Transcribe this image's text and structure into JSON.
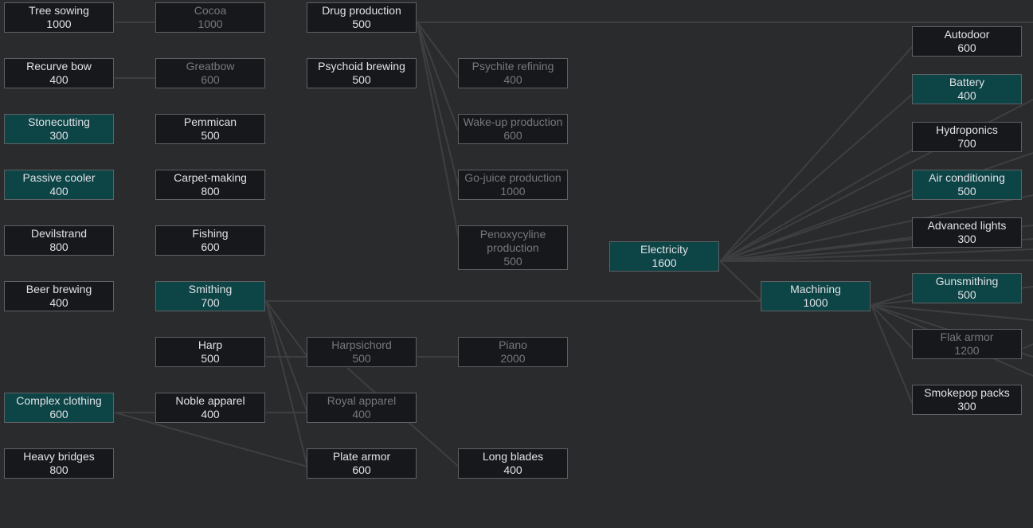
{
  "colors": {
    "background": "#2a2b2c",
    "node_default": "#17181c",
    "node_researched": "#0d4446",
    "node_border": "#5e6064",
    "text_available": "#dfe2e6",
    "text_locked": "#75787c",
    "connector": "#3e3f41"
  },
  "nodes": {
    "tree_sowing": {
      "name": "Tree sowing",
      "cost": "1000",
      "state": "available"
    },
    "recurve_bow": {
      "name": "Recurve bow",
      "cost": "400",
      "state": "available"
    },
    "stonecutting": {
      "name": "Stonecutting",
      "cost": "300",
      "state": "researched"
    },
    "passive_cooler": {
      "name": "Passive cooler",
      "cost": "400",
      "state": "researched"
    },
    "devilstrand": {
      "name": "Devilstrand",
      "cost": "800",
      "state": "available"
    },
    "beer_brewing": {
      "name": "Beer brewing",
      "cost": "400",
      "state": "available"
    },
    "complex_clothing": {
      "name": "Complex clothing",
      "cost": "600",
      "state": "researched"
    },
    "heavy_bridges": {
      "name": "Heavy bridges",
      "cost": "800",
      "state": "available"
    },
    "cocoa": {
      "name": "Cocoa",
      "cost": "1000",
      "state": "locked"
    },
    "greatbow": {
      "name": "Greatbow",
      "cost": "600",
      "state": "locked"
    },
    "pemmican": {
      "name": "Pemmican",
      "cost": "500",
      "state": "available"
    },
    "carpet_making": {
      "name": "Carpet-making",
      "cost": "800",
      "state": "available"
    },
    "fishing": {
      "name": "Fishing",
      "cost": "600",
      "state": "available"
    },
    "smithing": {
      "name": "Smithing",
      "cost": "700",
      "state": "researched"
    },
    "harp": {
      "name": "Harp",
      "cost": "500",
      "state": "available"
    },
    "noble_apparel": {
      "name": "Noble apparel",
      "cost": "400",
      "state": "available"
    },
    "drug_production": {
      "name": "Drug production",
      "cost": "500",
      "state": "available"
    },
    "psychoid_brewing": {
      "name": "Psychoid brewing",
      "cost": "500",
      "state": "available"
    },
    "harpsichord": {
      "name": "Harpsichord",
      "cost": "500",
      "state": "locked"
    },
    "royal_apparel": {
      "name": "Royal apparel",
      "cost": "400",
      "state": "locked"
    },
    "plate_armor": {
      "name": "Plate armor",
      "cost": "600",
      "state": "available"
    },
    "psychite_refining": {
      "name": "Psychite refining",
      "cost": "400",
      "state": "locked"
    },
    "wakeup_production": {
      "name": "Wake-up production",
      "cost": "600",
      "state": "locked"
    },
    "gojuice_production": {
      "name": "Go-juice production",
      "cost": "1000",
      "state": "locked"
    },
    "penoxycyline_production": {
      "name": "Penoxycyline production",
      "cost": "500",
      "state": "locked"
    },
    "piano": {
      "name": "Piano",
      "cost": "2000",
      "state": "locked"
    },
    "long_blades": {
      "name": "Long blades",
      "cost": "400",
      "state": "available"
    },
    "electricity": {
      "name": "Electricity",
      "cost": "1600",
      "state": "researched"
    },
    "machining": {
      "name": "Machining",
      "cost": "1000",
      "state": "researched"
    },
    "autodoor": {
      "name": "Autodoor",
      "cost": "600",
      "state": "available"
    },
    "battery": {
      "name": "Battery",
      "cost": "400",
      "state": "researched"
    },
    "hydroponics": {
      "name": "Hydroponics",
      "cost": "700",
      "state": "available"
    },
    "air_conditioning": {
      "name": "Air conditioning",
      "cost": "500",
      "state": "researched"
    },
    "advanced_lights": {
      "name": "Advanced lights",
      "cost": "300",
      "state": "available"
    },
    "gunsmithing": {
      "name": "Gunsmithing",
      "cost": "500",
      "state": "researched"
    },
    "flak_armor": {
      "name": "Flak armor",
      "cost": "1200",
      "state": "locked"
    },
    "smokepop_packs": {
      "name": "Smokepop packs",
      "cost": "300",
      "state": "available"
    }
  }
}
